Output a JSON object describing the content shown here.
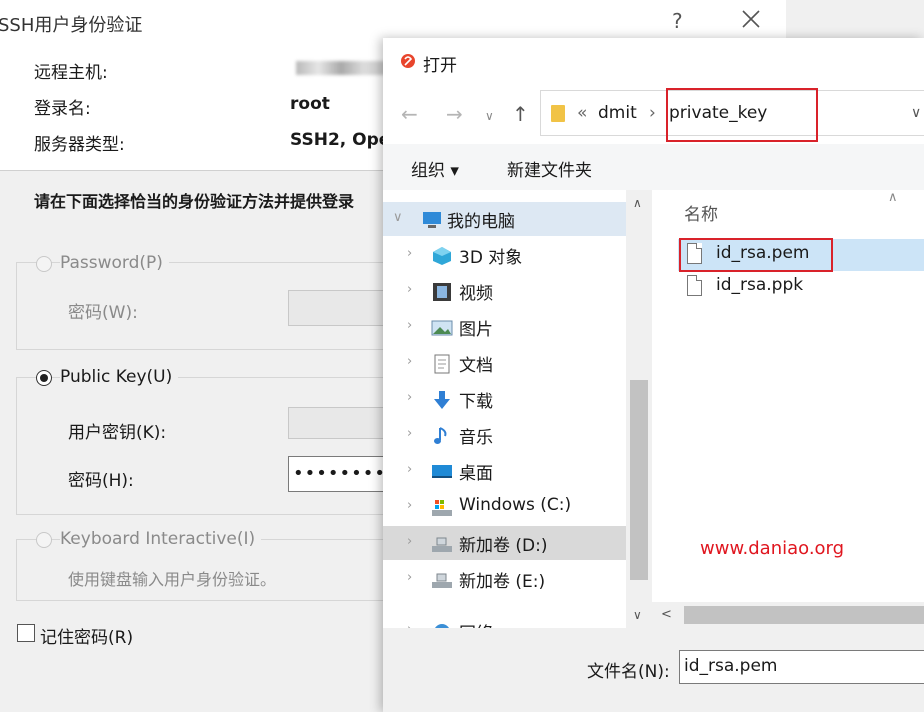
{
  "ssh_dialog": {
    "title": "SSH用户身份验证",
    "help_label": "?",
    "info": [
      {
        "label": "远程主机:",
        "value": ""
      },
      {
        "label": "登录名:",
        "value": "root"
      },
      {
        "label": "服务器类型:",
        "value": "SSH2, Ope"
      }
    ],
    "instruction": "请在下面选择恰当的身份验证方法并提供登录",
    "password_method": {
      "label": "Password(P)",
      "field_label": "密码(W):"
    },
    "public_key_method": {
      "label": "Public Key(U)",
      "key_label": "用户密钥(K):",
      "password_label": "密码(H):",
      "password_value": "••••••••"
    },
    "keyboard_method": {
      "label": "Keyboard Interactive(I)",
      "description": "使用键盘输入用户身份验证。"
    },
    "remember_password": "记住密码(R)"
  },
  "open_dialog": {
    "title": "打开",
    "address": {
      "overflow": "«",
      "crumbs": [
        "dmit",
        "private_key"
      ],
      "separator": "›"
    },
    "toolbar": {
      "organize": "组织 ▾",
      "new_folder": "新建文件夹"
    },
    "nav_items": [
      {
        "label": "我的电脑",
        "icon": "computer-icon"
      },
      {
        "label": "3D 对象",
        "icon": "3d-objects-icon"
      },
      {
        "label": "视频",
        "icon": "video-icon"
      },
      {
        "label": "图片",
        "icon": "pictures-icon"
      },
      {
        "label": "文档",
        "icon": "documents-icon"
      },
      {
        "label": "下载",
        "icon": "download-icon"
      },
      {
        "label": "音乐",
        "icon": "music-icon"
      },
      {
        "label": "桌面",
        "icon": "desktop-icon"
      },
      {
        "label": "Windows (C:)",
        "icon": "drive-icon"
      },
      {
        "label": "新加卷 (D:)",
        "icon": "drive-icon"
      },
      {
        "label": "新加卷 (E:)",
        "icon": "drive-icon"
      },
      {
        "label": "网络",
        "icon": "network-icon"
      }
    ],
    "column_header": "名称",
    "files": [
      "id_rsa.pem",
      "id_rsa.ppk"
    ],
    "filename_label": "文件名(N):",
    "filename_value": "id_rsa.pem"
  },
  "watermark": "www.daniao.org",
  "colors": {
    "highlight_red": "#d9222a",
    "selection_blue": "#cce4f7",
    "watermark_red": "#e0161f"
  }
}
